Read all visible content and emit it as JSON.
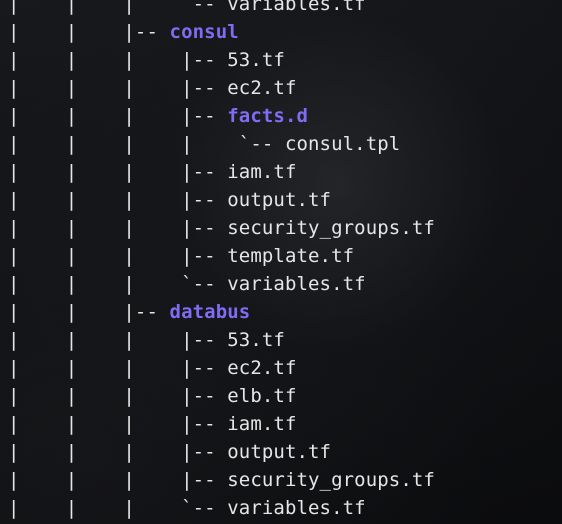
{
  "lines": [
    {
      "prefix": "|    |    |     -- ",
      "name": "variables.tf",
      "type": "file"
    },
    {
      "prefix": "|    |    |-- ",
      "name": "consul",
      "type": "dir"
    },
    {
      "prefix": "|    |    |    |-- ",
      "name": "53.tf",
      "type": "file"
    },
    {
      "prefix": "|    |    |    |-- ",
      "name": "ec2.tf",
      "type": "file"
    },
    {
      "prefix": "|    |    |    |-- ",
      "name": "facts.d",
      "type": "dir"
    },
    {
      "prefix": "|    |    |    |    `-- ",
      "name": "consul.tpl",
      "type": "file"
    },
    {
      "prefix": "|    |    |    |-- ",
      "name": "iam.tf",
      "type": "file"
    },
    {
      "prefix": "|    |    |    |-- ",
      "name": "output.tf",
      "type": "file"
    },
    {
      "prefix": "|    |    |    |-- ",
      "name": "security_groups.tf",
      "type": "file"
    },
    {
      "prefix": "|    |    |    |-- ",
      "name": "template.tf",
      "type": "file"
    },
    {
      "prefix": "|    |    |    `-- ",
      "name": "variables.tf",
      "type": "file"
    },
    {
      "prefix": "|    |    |-- ",
      "name": "databus",
      "type": "dir"
    },
    {
      "prefix": "|    |    |    |-- ",
      "name": "53.tf",
      "type": "file"
    },
    {
      "prefix": "|    |    |    |-- ",
      "name": "ec2.tf",
      "type": "file"
    },
    {
      "prefix": "|    |    |    |-- ",
      "name": "elb.tf",
      "type": "file"
    },
    {
      "prefix": "|    |    |    |-- ",
      "name": "iam.tf",
      "type": "file"
    },
    {
      "prefix": "|    |    |    |-- ",
      "name": "output.tf",
      "type": "file"
    },
    {
      "prefix": "|    |    |    |-- ",
      "name": "security_groups.tf",
      "type": "file"
    },
    {
      "prefix": "|    |    |    `-- ",
      "name": "variables.tf",
      "type": "file"
    }
  ],
  "colors": {
    "text": "#e6e6e6",
    "directory": "#7f6cf3",
    "background": "#0d0f12"
  }
}
